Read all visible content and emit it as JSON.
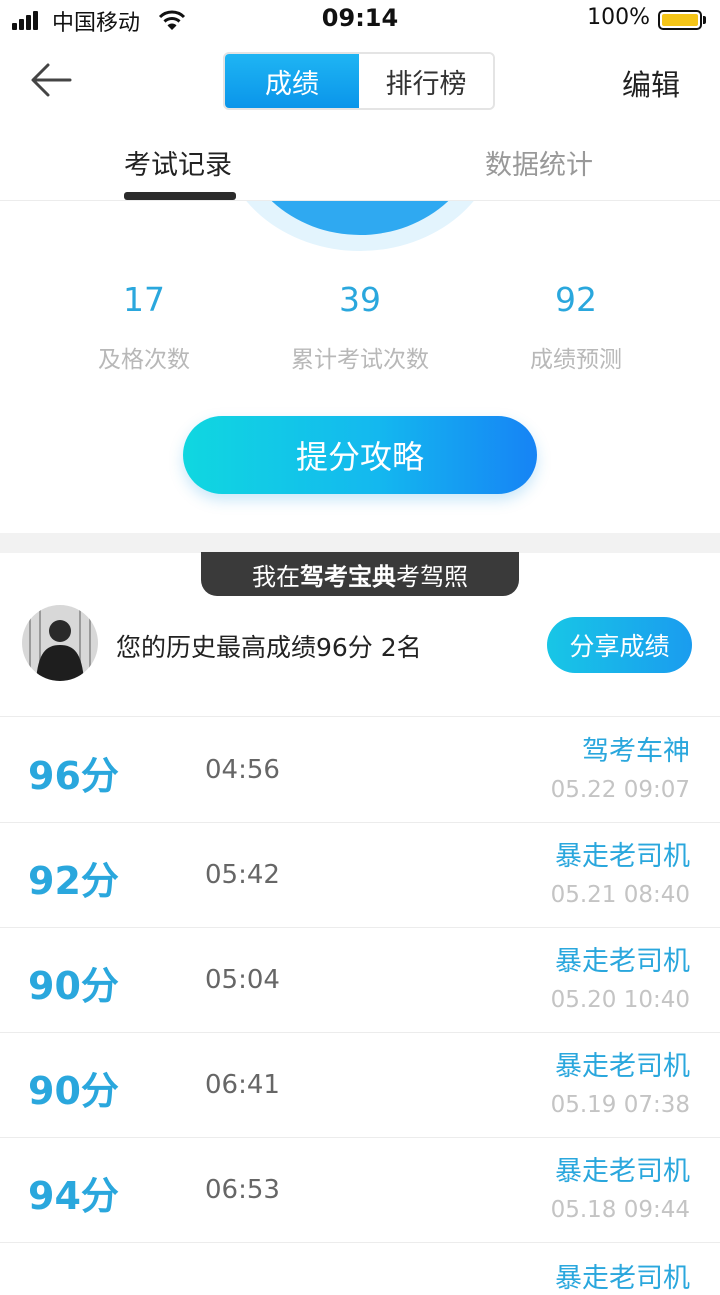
{
  "status_bar": {
    "carrier": "中国移动",
    "time": "09:14",
    "battery": "100%"
  },
  "nav": {
    "segments": [
      "成绩",
      "排行榜"
    ],
    "active_segment": "成绩",
    "edit_label": "编辑"
  },
  "tabs": [
    {
      "label": "考试记录",
      "active": true
    },
    {
      "label": "数据统计",
      "active": false
    }
  ],
  "stats": [
    {
      "value": "17",
      "label": "及格次数"
    },
    {
      "value": "39",
      "label": "累计考试次数"
    },
    {
      "value": "92",
      "label": "成绩预测"
    }
  ],
  "strategy_button": "提分攻略",
  "promo": {
    "prefix": "我在",
    "brand": "驾考宝典",
    "suffix": "考驾照"
  },
  "best": {
    "text": "您的历史最高成绩96分 2名",
    "share_label": "分享成绩"
  },
  "records": [
    {
      "score": "96分",
      "duration": "04:56",
      "title": "驾考车神",
      "date": "05.22 09:07"
    },
    {
      "score": "92分",
      "duration": "05:42",
      "title": "暴走老司机",
      "date": "05.21 08:40"
    },
    {
      "score": "90分",
      "duration": "05:04",
      "title": "暴走老司机",
      "date": "05.20 10:40"
    },
    {
      "score": "90分",
      "duration": "06:41",
      "title": "暴走老司机",
      "date": "05.19 07:38"
    },
    {
      "score": "94分",
      "duration": "06:53",
      "title": "暴走老司机",
      "date": "05.18 09:44"
    },
    {
      "score": "",
      "duration": "",
      "title": "暴走老司机",
      "date": ""
    }
  ],
  "colors": {
    "accent": "#2aa7dd",
    "segment_active": "#1fb5f3",
    "promo_bg": "#3a3a3a",
    "date_gray": "#c4c4c4"
  },
  "icons": [
    "signal-icon",
    "wifi-icon",
    "battery-icon",
    "back-arrow-icon"
  ]
}
